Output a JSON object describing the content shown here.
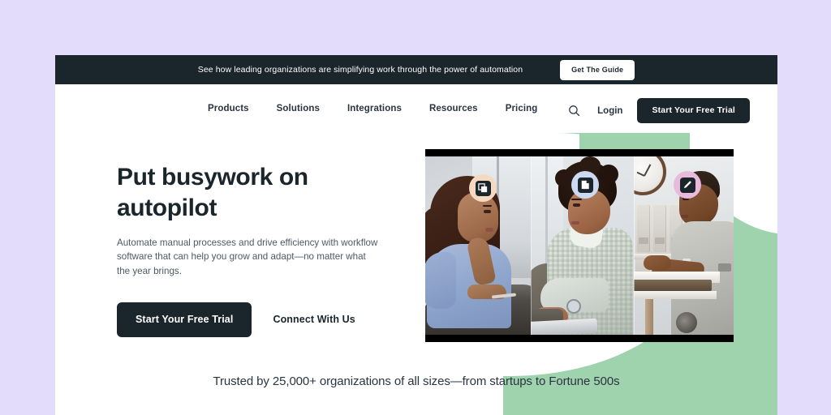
{
  "colors": {
    "page_background": "#e4dcfb",
    "canvas_background": "#ffffff",
    "dark": "#1b252c",
    "green_blob": "#9fd3ae",
    "badge_peach": "#f6d9c1",
    "badge_blue": "#ccd9f2",
    "badge_pink": "#e8bbdd",
    "body_text": "#4e5965"
  },
  "banner": {
    "text": "See how leading organizations are simplifying work through the power of automation",
    "cta_label": "Get The Guide"
  },
  "nav": {
    "links": [
      {
        "label": "Products"
      },
      {
        "label": "Solutions"
      },
      {
        "label": "Integrations"
      },
      {
        "label": "Resources"
      },
      {
        "label": "Pricing"
      }
    ],
    "search_icon": "search-icon",
    "login_label": "Login",
    "cta_label": "Start Your Free Trial"
  },
  "hero": {
    "headline": "Put busywork on autopilot",
    "subhead": "Automate manual processes and drive efficiency with workflow software that can help you grow and adapt—no matter what the year brings.",
    "primary_cta": "Start Your Free Trial",
    "secondary_cta": "Connect With Us",
    "badges": [
      {
        "name": "duplicate-icon",
        "glyph": "duplicate",
        "circle_color": "#f6d9c1"
      },
      {
        "name": "document-icon",
        "glyph": "document",
        "circle_color": "#ccd9f2"
      },
      {
        "name": "edit-pen-icon",
        "glyph": "pen",
        "circle_color": "#e8bbdd"
      }
    ],
    "image_alt": "Three-panel collage of office workers using laptops and desktops"
  },
  "trust": {
    "text": "Trusted by 25,000+ organizations of all sizes—from startups to Fortune 500s"
  }
}
